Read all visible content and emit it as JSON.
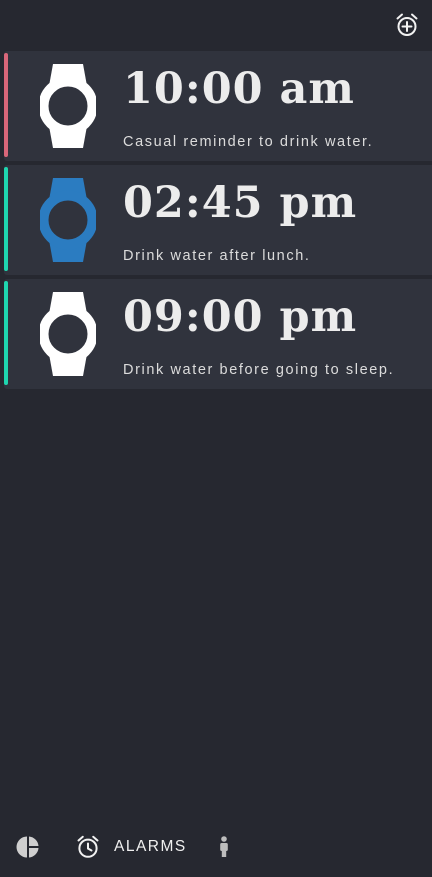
{
  "header": {
    "add_alarm_icon": "alarm-add-icon"
  },
  "alarms": [
    {
      "time": "10:00 am",
      "description": "Casual reminder to drink water.",
      "accent_color": "#d9677a",
      "watch_color": "#ffffff",
      "watch_icon": "watch-icon"
    },
    {
      "time": "02:45 pm",
      "description": "Drink water after lunch.",
      "accent_color": "#1fd6b0",
      "watch_color": "#2b7cc1",
      "watch_icon": "watch-icon"
    },
    {
      "time": "09:00 pm",
      "description": "Drink water before going to sleep.",
      "accent_color": "#1fd6b0",
      "watch_color": "#ffffff",
      "watch_icon": "watch-icon"
    }
  ],
  "bottom_nav": {
    "stats_icon": "pie-chart-icon",
    "alarms_icon": "alarm-clock-icon",
    "alarms_label": "ALARMS",
    "profile_icon": "person-icon"
  },
  "colors": {
    "background": "#262830",
    "card": "#30333d"
  }
}
